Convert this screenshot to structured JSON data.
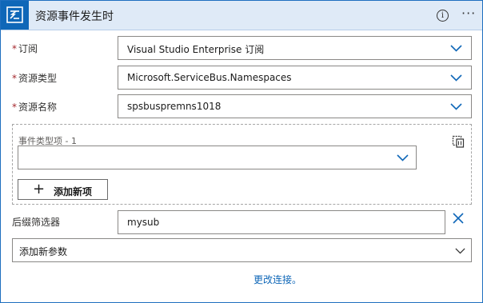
{
  "header": {
    "title": "资源事件发生时",
    "icon": "event-grid-icon",
    "info_icon": "i",
    "more_icon": "···"
  },
  "fields": {
    "subscription": {
      "label": "订阅",
      "required_mark": "*",
      "value": "Visual Studio Enterprise 订阅"
    },
    "resource_type": {
      "label": "资源类型",
      "required_mark": "*",
      "value": "Microsoft.ServiceBus.Namespaces"
    },
    "resource_name": {
      "label": "资源名称",
      "required_mark": "*",
      "value": "spsbuspremns1018"
    }
  },
  "event_types": {
    "item_label": "事件类型项 - 1",
    "item_value": "",
    "add_button_label": "添加新项",
    "add_button_icon": "+"
  },
  "suffix_filter": {
    "label": "后缀筛选器",
    "value": "mysub"
  },
  "add_param": {
    "label": "添加新参数"
  },
  "footer": {
    "change_connection_link": "更改连接。"
  },
  "colors": {
    "accent": "#0f67b8",
    "header_bg": "#dfeaf7",
    "required": "#a4262c"
  }
}
